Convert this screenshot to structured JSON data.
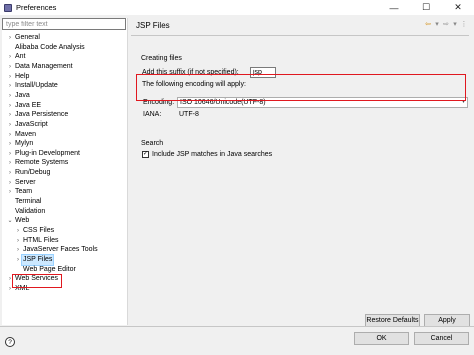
{
  "window": {
    "title": "Preferences",
    "minimize": "—",
    "maximize": "☐",
    "close": "✕"
  },
  "filter": {
    "placeholder": "type filter text"
  },
  "tree": [
    {
      "label": "General",
      "level": 0,
      "expander": "›"
    },
    {
      "label": "Alibaba Code Analysis",
      "level": 0,
      "expander": ""
    },
    {
      "label": "Ant",
      "level": 0,
      "expander": "›"
    },
    {
      "label": "Data Management",
      "level": 0,
      "expander": "›"
    },
    {
      "label": "Help",
      "level": 0,
      "expander": "›"
    },
    {
      "label": "Install/Update",
      "level": 0,
      "expander": "›"
    },
    {
      "label": "Java",
      "level": 0,
      "expander": "›"
    },
    {
      "label": "Java EE",
      "level": 0,
      "expander": "›"
    },
    {
      "label": "Java Persistence",
      "level": 0,
      "expander": "›"
    },
    {
      "label": "JavaScript",
      "level": 0,
      "expander": "›"
    },
    {
      "label": "Maven",
      "level": 0,
      "expander": "›"
    },
    {
      "label": "Mylyn",
      "level": 0,
      "expander": "›"
    },
    {
      "label": "Plug-in Development",
      "level": 0,
      "expander": "›"
    },
    {
      "label": "Remote Systems",
      "level": 0,
      "expander": "›"
    },
    {
      "label": "Run/Debug",
      "level": 0,
      "expander": "›"
    },
    {
      "label": "Server",
      "level": 0,
      "expander": "›"
    },
    {
      "label": "Team",
      "level": 0,
      "expander": "›"
    },
    {
      "label": "Terminal",
      "level": 0,
      "expander": ""
    },
    {
      "label": "Validation",
      "level": 0,
      "expander": ""
    },
    {
      "label": "Web",
      "level": 0,
      "expander": "⌄"
    },
    {
      "label": "CSS Files",
      "level": 1,
      "expander": "›"
    },
    {
      "label": "HTML Files",
      "level": 1,
      "expander": "›"
    },
    {
      "label": "JavaServer Faces Tools",
      "level": 1,
      "expander": "›"
    },
    {
      "label": "JSP Files",
      "level": 1,
      "expander": "›",
      "selected": true
    },
    {
      "label": "Web Page Editor",
      "level": 1,
      "expander": ""
    },
    {
      "label": "Web Services",
      "level": 0,
      "expander": "›"
    },
    {
      "label": "XML",
      "level": 0,
      "expander": "›"
    }
  ],
  "page": {
    "title": "JSP Files",
    "nav_back": "⇦",
    "nav_back_menu": "▾",
    "nav_forward": "⇨",
    "nav_forward_menu": "▾",
    "nav_menu": "⋮",
    "creating_files": "Creating files",
    "suffix_label": "Add this suffix (if not specified):",
    "suffix_value": "jsp",
    "encoding_intro": "The following encoding will apply:",
    "encoding_label": "Encoding:",
    "encoding_value": "ISO 10646/Unicode(UTF-8)",
    "iana_label": "IANA:",
    "iana_value": "UTF-8",
    "search_label": "Search",
    "include_jsp_label": "Include JSP matches in Java searches",
    "include_jsp_checked": true,
    "checkmark": "✓"
  },
  "buttons": {
    "restore_defaults": "Restore Defaults",
    "apply": "Apply",
    "ok": "OK",
    "cancel": "Cancel",
    "help": "?"
  }
}
